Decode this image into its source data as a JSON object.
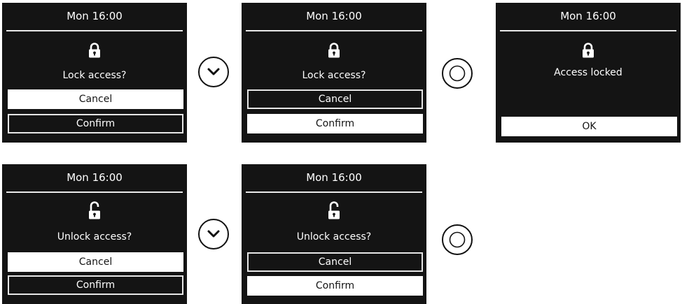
{
  "time_label": "Mon 16:00",
  "buttons": {
    "cancel": "Cancel",
    "confirm": "Confirm",
    "ok": "OK"
  },
  "messages": {
    "lock_prompt": "Lock access?",
    "unlock_prompt": "Unlock access?",
    "locked": "Access locked"
  },
  "icons": {
    "locked": "padlock-closed-icon",
    "unlocked": "padlock-open-icon",
    "down": "chevron-down-icon",
    "press": "circle-press-icon"
  },
  "colors": {
    "screen_bg": "#141414",
    "foreground": "#ffffff",
    "page_bg": "#ffffff"
  }
}
